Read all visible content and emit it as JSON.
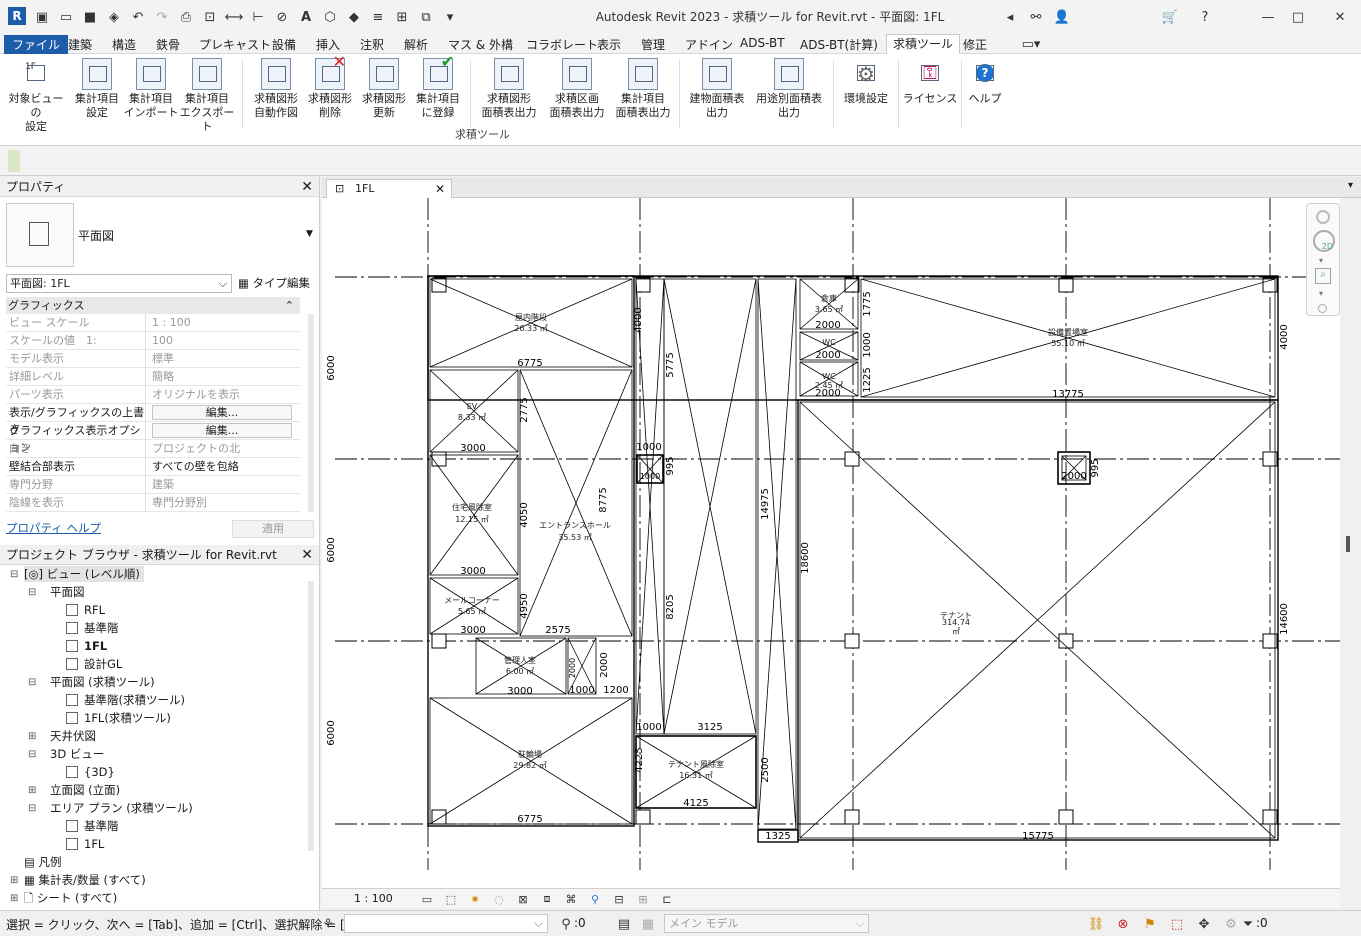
{
  "title": {
    "text": "Autodesk Revit 2023 - 求積ツール for Revit.rvt - 平面図: 1FL"
  },
  "menu": {
    "file": "ファイル",
    "items": [
      "建築",
      "構造",
      "鉄骨",
      "プレキャスト",
      "設備",
      "挿入",
      "注釈",
      "解析",
      "マス & 外構",
      "コラボレート",
      "表示",
      "管理",
      "アドイン",
      "ADS-BT",
      "ADS-BT(計算)",
      "求積ツール",
      "修正"
    ]
  },
  "ribbon": {
    "buttons": [
      {
        "l1": "対象ビューの",
        "l2": "設定"
      },
      {
        "l1": "集計項目",
        "l2": "設定"
      },
      {
        "l1": "集計項目",
        "l2": "インポート"
      },
      {
        "l1": "集計項目",
        "l2": "エクスポート"
      },
      {
        "l1": "求積図形",
        "l2": "自動作図"
      },
      {
        "l1": "求積図形",
        "l2": "削除"
      },
      {
        "l1": "求積図形",
        "l2": "更新"
      },
      {
        "l1": "集計項目",
        "l2": "に登録"
      },
      {
        "l1": "求積図形",
        "l2": "面積表出力"
      },
      {
        "l1": "求積区画",
        "l2": "面積表出力"
      },
      {
        "l1": "集計項目",
        "l2": "面積表出力"
      },
      {
        "l1": "建物面積表",
        "l2": "出力"
      },
      {
        "l1": "用途別面積表",
        "l2": "出力"
      },
      {
        "l1": "環境設定",
        "l2": ""
      },
      {
        "l1": "ライセンス",
        "l2": ""
      },
      {
        "l1": "ヘルプ",
        "l2": ""
      }
    ],
    "panel_title": "求積ツール",
    "icon_mini": "1F"
  },
  "properties": {
    "header": "プロパティ",
    "type_name": "平面図",
    "selector": "平面図: 1FL",
    "type_edit": "タイプ編集",
    "group": "グラフィックス",
    "rows": [
      {
        "k": "ビュー スケール",
        "v": "1 : 100"
      },
      {
        "k": "スケールの値　1:",
        "v": "100"
      },
      {
        "k": "モデル表示",
        "v": "標準"
      },
      {
        "k": "詳細レベル",
        "v": "簡略"
      },
      {
        "k": "パーツ表示",
        "v": "オリジナルを表示"
      },
      {
        "k": "表示/グラフィックスの上書き",
        "v": "編集..."
      },
      {
        "k": "グラフィックス表示オプション",
        "v": "編集..."
      },
      {
        "k": "向き",
        "v": "プロジェクトの北"
      },
      {
        "k": "壁結合部表示",
        "v": "すべての壁を包絡"
      },
      {
        "k": "専門分野",
        "v": "建築"
      },
      {
        "k": "陰線を表示",
        "v": "専門分野別"
      }
    ],
    "help": "プロパティ ヘルプ",
    "apply": "適用"
  },
  "browser": {
    "header": "プロジェクト ブラウザ - 求積ツール for Revit.rvt",
    "nodes": [
      "ビュー (レベル順)",
      "平面図",
      "RFL",
      "基準階",
      "1FL",
      "設計GL",
      "平面図 (求積ツール)",
      "基準階(求積ツール)",
      "1FL(求積ツール)",
      "天井伏図",
      "3D ビュー",
      "{3D}",
      "立面図 (立面)",
      "エリア プラン (求積ツール)",
      "基準階",
      "1FL",
      "凡例",
      "集計表/数量 (すべて)",
      "シート (すべて)"
    ]
  },
  "view": {
    "tab": "1FL",
    "scale": "1 : 100",
    "rooms": [
      {
        "n": "屋内階段",
        "a": "26.33 ㎡"
      },
      {
        "n": "倉庫",
        "a": "3.65 ㎡"
      },
      {
        "n": "WC",
        "a": ""
      },
      {
        "n": "WC",
        "a": "2.45 ㎡"
      },
      {
        "n": "設備置場室",
        "a": "55.10 ㎡"
      },
      {
        "n": "EV",
        "a": "8.33 ㎡"
      },
      {
        "n": "住宅風除室",
        "a": "12.15 ㎡"
      },
      {
        "n": "エントランスホール",
        "a": "35.53 ㎡"
      },
      {
        "n": "メールコーナー",
        "a": "5.65 ㎡"
      },
      {
        "n": "テナント",
        "a": "314.74"
      },
      {
        "n": "管理人室",
        "a": "6.00 ㎡"
      },
      {
        "n": "駐輪場",
        "a": "29.82 ㎡"
      },
      {
        "n": "テナント風除室",
        "a": "16.31 ㎡"
      }
    ],
    "dims": [
      "6775",
      "3000",
      "3000",
      "3000",
      "3000",
      "2575",
      "3000",
      "1000",
      "1200",
      "6775",
      "1000",
      "3125",
      "4125",
      "1325",
      "15775",
      "13775",
      "2000",
      "2000",
      "2000",
      "1000",
      "6000",
      "6000",
      "6000",
      "5775",
      "4050",
      "8775",
      "8205",
      "14975",
      "18600",
      "4000",
      "14600",
      "2775",
      "4950",
      "2000",
      "2500",
      "4225",
      "1775",
      "1000",
      "1225",
      "995",
      "995",
      "1000"
    ],
    "tenant_unit": "㎡"
  },
  "status": {
    "hint": "選択 = クリック、次へ = [Tab]、追加 = [Ctrl]、選択解除 = [Shift]",
    "count": ":0",
    "model": "メイン モデル",
    "filter": ":0"
  }
}
